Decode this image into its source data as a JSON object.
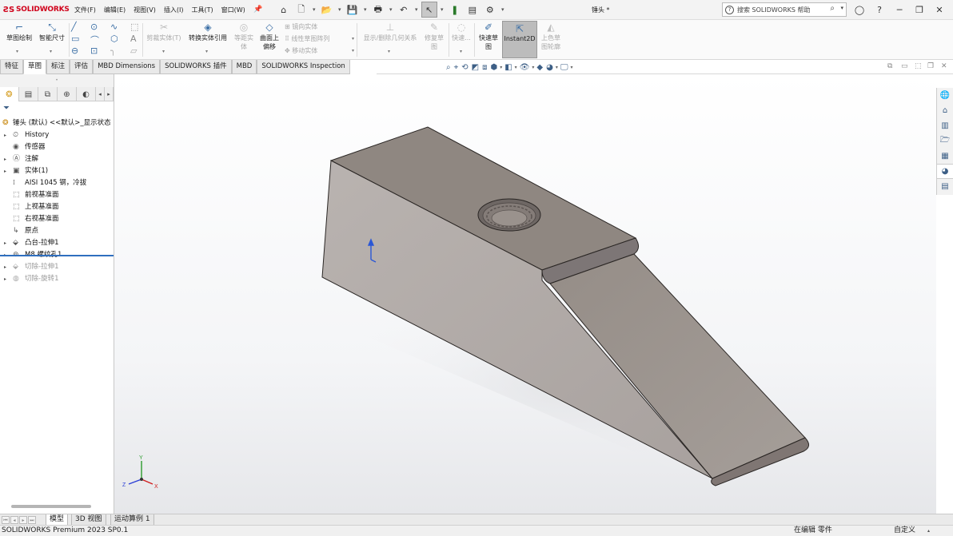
{
  "app": {
    "brand": "SOLIDWORKS",
    "doc_title": "锤头 *"
  },
  "menu": [
    "文件(F)",
    "编辑(E)",
    "视图(V)",
    "插入(I)",
    "工具(T)",
    "窗口(W)"
  ],
  "search": {
    "placeholder": "搜索 SOLIDWORKS 帮助"
  },
  "ribbon": {
    "sketch": "草图绘制",
    "smart_dim": "智能尺寸",
    "trim1": "剪裁实体(T)",
    "convert": "转换实体引用",
    "offset1": "等距实",
    "offset2": "体",
    "surface_offset1": "曲面上",
    "surface_offset2": "偏移",
    "mirror": "镜向实体",
    "linear_pattern": "线性草图阵列",
    "move": "移动实体",
    "relations": "显示/删除几何关系",
    "repair1": "修复草",
    "repair2": "图",
    "quick_snap": "快速...",
    "rapid1": "快速草",
    "rapid2": "图",
    "instant2d": "Instant2D",
    "shaded1": "上色草",
    "shaded2": "图轮廓"
  },
  "cm_tabs": [
    "特征",
    "草图",
    "标注",
    "评估",
    "MBD Dimensions",
    "SOLIDWORKS 插件",
    "MBD",
    "SOLIDWORKS Inspection"
  ],
  "cm_active": "草图",
  "tree": {
    "root": "锤头 (默认) <<默认>_显示状态",
    "items": [
      "History",
      "传感器",
      "注解",
      "实体(1)",
      "AISI 1045 钢，冷拔",
      "前视基准面",
      "上视基准面",
      "右视基准面",
      "原点",
      "凸台-拉伸1",
      "M8 螺纹孔1",
      "切除-拉伸1",
      "切除-旋转1"
    ]
  },
  "triad": {
    "x": "X",
    "y": "Y",
    "z": "Z"
  },
  "bottom_tabs": [
    "模型",
    "3D 视图",
    "运动算例 1"
  ],
  "status": {
    "version": "SOLIDWORKS Premium 2023 SP0.1",
    "mode": "在编辑 零件",
    "custom": "自定义"
  },
  "colors": {
    "brand_red": "#d0021b",
    "part_top": "#8f8781",
    "part_side": "#b3adaa",
    "part_slope": "#9e9792",
    "accent_blue": "#2f6fbf"
  }
}
